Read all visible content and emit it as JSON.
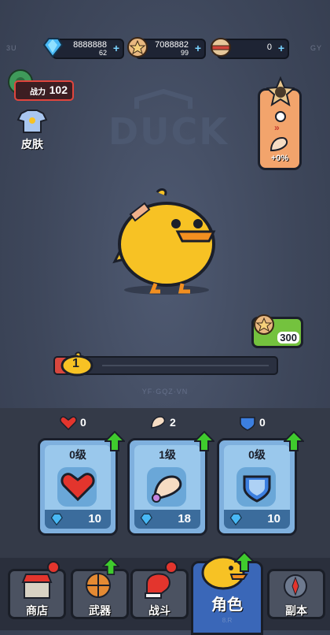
{
  "currency": {
    "gems": {
      "amount": "8888888",
      "sub": "62",
      "icon": "gem-icon"
    },
    "coins": {
      "amount": "7088882",
      "sub": "99",
      "icon": "star-coin-icon"
    },
    "special": {
      "amount": "0",
      "icon": "capsule-icon"
    },
    "plus_label": "+"
  },
  "corner": {
    "left": "3U",
    "right": "GY"
  },
  "power": {
    "label": "战力",
    "value": "102"
  },
  "skin": {
    "label": "皮肤"
  },
  "stage": {
    "bonus": "+0%"
  },
  "backdrop_logo": "DUCK",
  "reward": {
    "value": "300"
  },
  "progress": {
    "level": "1",
    "fraction": 0.05
  },
  "watermark": "YF·GQZ·VN",
  "stats": [
    {
      "icon": "heart-icon",
      "count": "0",
      "level": "0级",
      "cost": "10"
    },
    {
      "icon": "arm-icon",
      "count": "2",
      "level": "1级",
      "cost": "18"
    },
    {
      "icon": "shield-icon",
      "count": "0",
      "level": "0级",
      "cost": "10"
    }
  ],
  "nav": {
    "shop": "商店",
    "weapon": "武器",
    "battle": "战斗",
    "character": "角色",
    "dungeon": "副本"
  },
  "version": "8.R",
  "colors": {
    "accent_green": "#3fcb2d",
    "accent_red": "#e3352d",
    "panel_blue": "#7fb0de",
    "duck_yellow": "#f7c224"
  }
}
